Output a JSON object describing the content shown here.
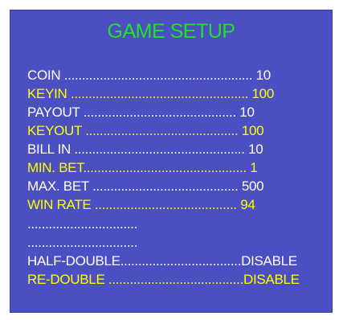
{
  "screen": {
    "title": "GAME SETUP",
    "colors": {
      "background": "#4b4fc2",
      "title": "#22e022",
      "white_text": "#ffffff",
      "yellow_text": "#ffff00"
    },
    "rows": [
      {
        "label": "COIN ..................................................... 10",
        "color": "white"
      },
      {
        "label": "KEYIN .................................................. 100",
        "color": "yellow"
      },
      {
        "label": "PAYOUT ........................................... 10",
        "color": "white"
      },
      {
        "label": "KEYOUT ........................................... 100",
        "color": "yellow"
      },
      {
        "label": "BILL IN ................................................ 10",
        "color": "white"
      },
      {
        "label": "MIN. BET.............................................. 1",
        "color": "yellow"
      },
      {
        "label": "MAX. BET ......................................... 500",
        "color": "white"
      },
      {
        "label": "WIN RATE ........................................ 94",
        "color": "yellow"
      },
      {
        "label": "...............................",
        "color": "white"
      },
      {
        "label": "...............................",
        "color": "white"
      },
      {
        "label": "HALF-DOUBLE..................................DISABLE",
        "color": "white"
      },
      {
        "label": "RE-DOUBLE ......................................DISABLE",
        "color": "yellow"
      }
    ]
  }
}
